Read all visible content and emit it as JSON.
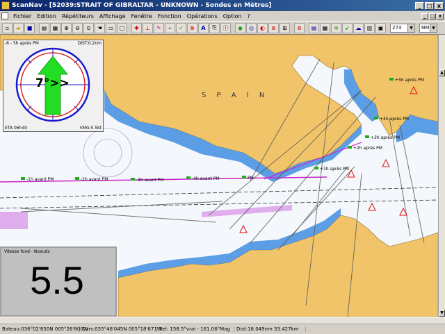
{
  "window": {
    "title": "ScanNav - [52039:STRAIT OF GIBRALTAR - UNKNOWN - Sondes en Mètres]",
    "controls": [
      "_",
      "□",
      "x"
    ]
  },
  "menu": {
    "items": [
      "Fichier",
      "Edition",
      "Répétiteurs",
      "Affichage",
      "Fenêtre",
      "Fonction",
      "Opérations",
      "Option",
      "?"
    ]
  },
  "toolbar": {
    "zoom_value": "273",
    "unit_value": "NM"
  },
  "chart": {
    "region_label": "S P A I N",
    "waypoint_labels": [
      "-1h avant PM",
      "-2h avant PM",
      "-3h avant PM",
      "-4h avant PM",
      "PM",
      "+1h après PM",
      "+2h après PM",
      "+3h après PM",
      "+4h après PM",
      "+5h après PM"
    ]
  },
  "compass": {
    "top_left": "-6 - 5h après PM",
    "top_right": "DIST:0.2nm",
    "bottom_left": "ETA 06h40",
    "bottom_right": "VMG:5.5kt",
    "value": "7°>>",
    "current_color": "#22dd22"
  },
  "speed": {
    "label": "Vitesse fond - Noeuds",
    "value": "5.5"
  },
  "status": {
    "bateau": "Bateau:036°02'850N 005°26'800W",
    "curs": "Curs:035°46'045N 005°18'671W",
    "rel": "Rel: 158.5°vrai - 161.06°Mag",
    "dist": "Dist:18.049nm  33.427km"
  },
  "colors": {
    "land": "#f2c46a",
    "shallow": "#3f8ee0",
    "sea": "#f4f7fb",
    "route": "#cc22cc"
  }
}
